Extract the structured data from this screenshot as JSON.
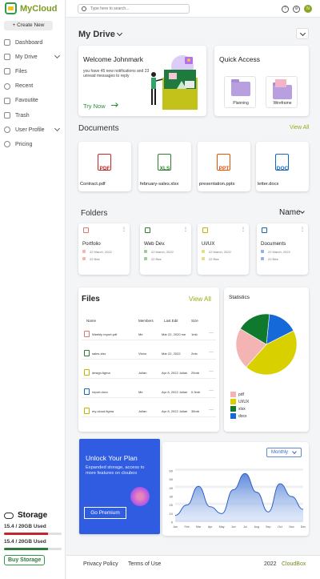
{
  "app": {
    "name": "MyCloud"
  },
  "sidebar": {
    "create_label": "+ Create New",
    "items": [
      {
        "label": "Dashboard",
        "icon": "dashboard-icon"
      },
      {
        "label": "My Drive",
        "icon": "drive-icon",
        "expandable": true
      },
      {
        "label": "Files",
        "icon": "file-icon"
      },
      {
        "label": "Recent",
        "icon": "clock-icon"
      },
      {
        "label": "Favoutite",
        "icon": "star-icon"
      },
      {
        "label": "Trash",
        "icon": "trash-icon"
      },
      {
        "label": "User Profile",
        "icon": "user-icon",
        "expandable": true
      },
      {
        "label": "Pricing",
        "icon": "tag-icon"
      }
    ],
    "storage": {
      "title": "Storage",
      "used_1": "15.4 / 20GB Used",
      "used_2": "15.4 / 20GB Used",
      "fraction": 0.77,
      "buy_label": "Buy Storage"
    }
  },
  "topbar": {
    "search_placeholder": "Type here to search...",
    "avatar_initial": "N"
  },
  "main": {
    "title": "My Drive",
    "welcome": {
      "heading": "Welcome Johnmark",
      "message": "you have 45 new notifications and 23 unread messages to reply",
      "cta": "Try Now"
    },
    "quick_access": {
      "title": "Quick Access",
      "items": [
        {
          "label": "Planning"
        },
        {
          "label": "Wireframe"
        }
      ]
    },
    "documents": {
      "title": "Documents",
      "view_all": "View All",
      "items": [
        {
          "type": "PDF",
          "name": "Contract.pdf",
          "color": "#c62828"
        },
        {
          "type": "XLS",
          "name": "february-sales.xlsx",
          "color": "#2e7d32"
        },
        {
          "type": "PPT",
          "name": "presentation.pptx",
          "color": "#e65100"
        },
        {
          "type": "DOC",
          "name": "letter.docx",
          "color": "#1565c0"
        }
      ]
    },
    "folders": {
      "title": "Folders",
      "sort": "Name",
      "items": [
        {
          "name": "Portfolio",
          "date": "22 March, 2022",
          "files": "22 files",
          "color": "#e57373"
        },
        {
          "name": "Web Dev.",
          "date": "22 March, 2022",
          "files": "22 files",
          "color": "#2e7d32"
        },
        {
          "name": "UI/UX",
          "date": "22 March, 2022",
          "files": "22 files",
          "color": "#c0b400"
        },
        {
          "name": "Documents",
          "date": "22 March, 2022",
          "files": "22 files",
          "color": "#1565c0"
        }
      ]
    },
    "files": {
      "title": "Files",
      "view_all": "View All",
      "columns": [
        "Name",
        "Members",
        "Last Edit",
        "Size"
      ],
      "rows": [
        {
          "name": "Weekly report.pdf",
          "member": "Me",
          "edit": "Mar 22, 2020 me",
          "size": "1mb",
          "color": "#e57373"
        },
        {
          "name": "sales.xlsx",
          "member": "Victor",
          "edit": "Mar 22, 2022",
          "size": "2mb",
          "color": "#2e7d32"
        },
        {
          "name": "design.figma",
          "member": "Julian",
          "edit": "Apr 8, 2022 Julian",
          "size": "25mb",
          "color": "#c0b400"
        },
        {
          "name": "report.docx",
          "member": "Me",
          "edit": "Apr 8, 2022 Julian",
          "size": "0.3mb",
          "color": "#1565c0"
        },
        {
          "name": "my-cloud.figma",
          "member": "Julian",
          "edit": "Apr 8, 2022 Julian",
          "size": "35mb",
          "color": "#c0b400"
        }
      ]
    },
    "statistics": {
      "title": "Statistics",
      "slices": [
        {
          "label": "pdf",
          "value": 22,
          "color": "#f4b4b4"
        },
        {
          "label": "UI/UX",
          "value": 44,
          "color": "#d9d000"
        },
        {
          "label": "xlsx",
          "value": 18,
          "color": "#0f7a2e"
        },
        {
          "label": "docx",
          "value": 16,
          "color": "#1569d8"
        }
      ]
    },
    "promo": {
      "title": "Unlock Your Plan",
      "text": "Expanded storage, access to more features on cloubox",
      "button": "Go Premium"
    },
    "usage_chart": {
      "period": "Monthly",
      "months": [
        "Jan",
        "Feb",
        "Mar",
        "Apr",
        "May",
        "Jun",
        "Jul",
        "Aug",
        "Sep",
        "Oct",
        "Nov",
        "Dec"
      ],
      "y_ticks": [
        "60",
        "50",
        "40",
        "30",
        "20",
        "10",
        "0"
      ]
    }
  },
  "chart_data": {
    "type": "area",
    "categories": [
      "Jan",
      "Feb",
      "Mar",
      "Apr",
      "May",
      "Jun",
      "Jul",
      "Aug",
      "Sep",
      "Oct",
      "Nov",
      "Dec"
    ],
    "values": [
      8,
      20,
      42,
      18,
      10,
      38,
      57,
      35,
      12,
      45,
      30,
      15
    ],
    "ylim": [
      0,
      60
    ]
  },
  "footer": {
    "privacy": "Privacy Policy",
    "terms": "Terms of Use",
    "year": "2022",
    "brand": "CloudBox"
  }
}
